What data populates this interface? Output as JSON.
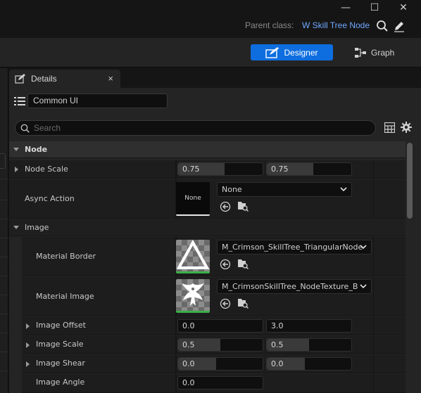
{
  "titlebar": {
    "minimize": "—",
    "maximize": "☐",
    "close": "✕",
    "parent_class_label": "Parent class:",
    "parent_class_value": "W Skill Tree Node"
  },
  "modes": {
    "designer_label": "Designer",
    "graph_label": "Graph"
  },
  "details": {
    "tab_label": "Details",
    "close": "×",
    "common_ui": "Common UI",
    "search_placeholder": "Search"
  },
  "sections": {
    "node": "Node",
    "image": "Image"
  },
  "rows": {
    "node_scale": {
      "label": "Node Scale",
      "x": "0.75",
      "y": "0.75",
      "x_fill": 0.55,
      "y_fill": 0.55
    },
    "async_action": {
      "label": "Async Action",
      "thumb": "None",
      "value": "None"
    },
    "material_border": {
      "label": "Material Border",
      "value": "M_Crimson_SkillTree_TriangularNode"
    },
    "material_image": {
      "label": "Material Image",
      "value": "M_CrimsonSkillTree_NodeTexture_B"
    },
    "image_offset": {
      "label": "Image Offset",
      "x": "0.0",
      "y": "3.0"
    },
    "image_scale": {
      "label": "Image Scale",
      "x": "0.5",
      "y": "0.5",
      "x_fill": 0.5,
      "y_fill": 0.5
    },
    "image_shear": {
      "label": "Image Shear",
      "x": "0.0",
      "y": "0.0",
      "x_fill": 0.45,
      "y_fill": 0.45
    },
    "image_angle": {
      "label": "Image Angle",
      "x": "0.0"
    }
  },
  "colors": {
    "accent": "#0e6ee0",
    "link": "#6fa8ff",
    "green": "#3bb04a"
  }
}
